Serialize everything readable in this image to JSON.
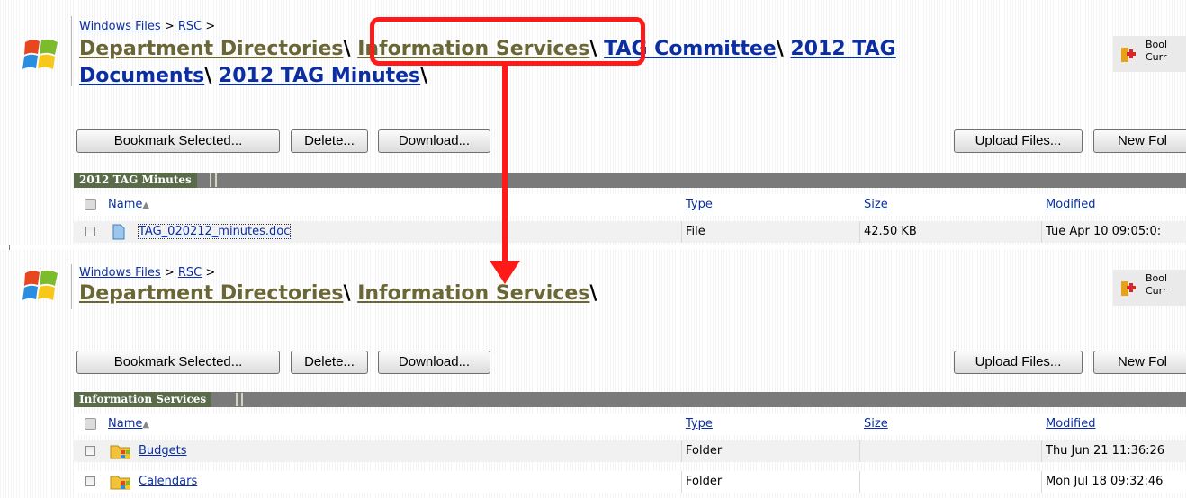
{
  "top": {
    "crumb": {
      "a": "Windows Files",
      "sep1": " > ",
      "b": "RSC",
      "sep2": " >"
    },
    "path": [
      "Department Directories",
      "Information Services",
      "TAG Committee",
      "2012 TAG",
      "Documents",
      "2012 TAG Minutes"
    ],
    "path_sep": "\\",
    "bookmark_side": {
      "line1": "Bool",
      "line2": "Curr"
    },
    "buttons": {
      "bookmark": "Bookmark Selected...",
      "delete": "Delete...",
      "download": "Download...",
      "upload": "Upload Files...",
      "newfolder": "New Fol"
    },
    "table_title": "2012 TAG Minutes",
    "headers": {
      "name": "Name",
      "type": "Type",
      "size": "Size",
      "modified": "Modified"
    },
    "rows": [
      {
        "name": "TAG_020212_minutes.doc",
        "type": "File",
        "size": "42.50 KB",
        "modified": "Tue Apr 10 09:05:0:",
        "icon": "document-icon"
      }
    ]
  },
  "bottom": {
    "crumb": {
      "a": "Windows Files",
      "sep1": " > ",
      "b": "RSC",
      "sep2": " >"
    },
    "path": [
      "Department Directories",
      "Information Services"
    ],
    "path_sep": "\\",
    "bookmark_side": {
      "line1": "Bool",
      "line2": "Curr"
    },
    "buttons": {
      "bookmark": "Bookmark Selected...",
      "delete": "Delete...",
      "download": "Download...",
      "upload": "Upload Files...",
      "newfolder": "New Fol"
    },
    "table_title": "Information Services",
    "headers": {
      "name": "Name",
      "type": "Type",
      "size": "Size",
      "modified": "Modified"
    },
    "rows": [
      {
        "name": "Budgets",
        "type": "Folder",
        "size": "",
        "modified": "Thu Jun 21 11:36:26",
        "icon": "shared-folder-icon"
      },
      {
        "name": "Calendars",
        "type": "Folder",
        "size": "",
        "modified": "Mon Jul 18 09:32:46",
        "icon": "shared-folder-icon"
      }
    ]
  },
  "colors": {
    "annotation": "#ff1a1a",
    "olive_link": "#6b6635",
    "blue_link": "#0b2fa3",
    "tab_bg": "#5a6b4a",
    "bar_bg": "#7a7a7a"
  }
}
